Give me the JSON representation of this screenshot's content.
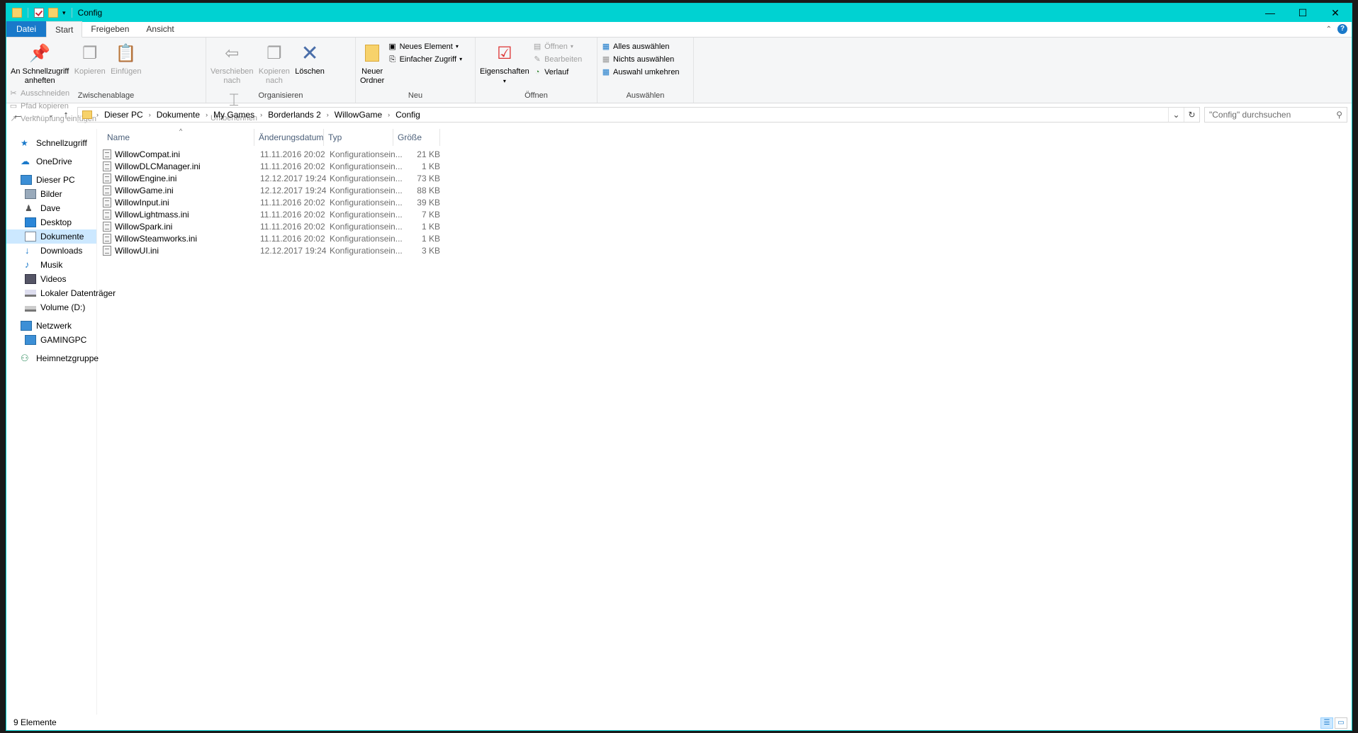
{
  "window": {
    "title": "Config",
    "minimize": "—",
    "maximize": "☐",
    "close": "✕"
  },
  "tabs": {
    "file": "Datei",
    "start": "Start",
    "share": "Freigeben",
    "view": "Ansicht"
  },
  "ribbon": {
    "clipboard": {
      "label": "Zwischenablage",
      "pin_line1": "An Schnellzugriff",
      "pin_line2": "anheften",
      "copy": "Kopieren",
      "paste": "Einfügen",
      "cut": "Ausschneiden",
      "copy_path": "Pfad kopieren",
      "paste_shortcut": "Verknüpfung einfügen"
    },
    "organize": {
      "label": "Organisieren",
      "move_line1": "Verschieben",
      "move_line2": "nach",
      "copyto_line1": "Kopieren",
      "copyto_line2": "nach",
      "delete": "Löschen",
      "rename": "Umbenennen"
    },
    "new": {
      "label": "Neu",
      "new_folder_line1": "Neuer",
      "new_folder_line2": "Ordner",
      "new_item": "Neues Element",
      "easy_access": "Einfacher Zugriff"
    },
    "open": {
      "label": "Öffnen",
      "properties": "Eigenschaften",
      "open": "Öffnen",
      "edit": "Bearbeiten",
      "history": "Verlauf"
    },
    "select": {
      "label": "Auswählen",
      "select_all": "Alles auswählen",
      "select_none": "Nichts auswählen",
      "invert": "Auswahl umkehren"
    }
  },
  "address": {
    "crumbs": [
      "Dieser PC",
      "Dokumente",
      "My Games",
      "Borderlands 2",
      "WillowGame",
      "Config"
    ],
    "search_placeholder": "\"Config\" durchsuchen"
  },
  "nav": {
    "quick_access": "Schnellzugriff",
    "onedrive": "OneDrive",
    "this_pc": "Dieser PC",
    "pictures": "Bilder",
    "dave": "Dave",
    "desktop": "Desktop",
    "documents": "Dokumente",
    "downloads": "Downloads",
    "music": "Musik",
    "videos": "Videos",
    "local_disk": "Lokaler Datenträger",
    "volume_d": "Volume (D:)",
    "network": "Netzwerk",
    "gamingpc": "GAMINGPC",
    "homegroup": "Heimnetzgruppe"
  },
  "columns": {
    "name": "Name",
    "date": "Änderungsdatum",
    "type": "Typ",
    "size": "Größe"
  },
  "files": [
    {
      "name": "WillowCompat.ini",
      "date": "11.11.2016 20:02",
      "type": "Konfigurationsein...",
      "size": "21 KB"
    },
    {
      "name": "WillowDLCManager.ini",
      "date": "11.11.2016 20:02",
      "type": "Konfigurationsein...",
      "size": "1 KB"
    },
    {
      "name": "WillowEngine.ini",
      "date": "12.12.2017 19:24",
      "type": "Konfigurationsein...",
      "size": "73 KB"
    },
    {
      "name": "WillowGame.ini",
      "date": "12.12.2017 19:24",
      "type": "Konfigurationsein...",
      "size": "88 KB"
    },
    {
      "name": "WillowInput.ini",
      "date": "11.11.2016 20:02",
      "type": "Konfigurationsein...",
      "size": "39 KB"
    },
    {
      "name": "WillowLightmass.ini",
      "date": "11.11.2016 20:02",
      "type": "Konfigurationsein...",
      "size": "7 KB"
    },
    {
      "name": "WillowSpark.ini",
      "date": "11.11.2016 20:02",
      "type": "Konfigurationsein...",
      "size": "1 KB"
    },
    {
      "name": "WillowSteamworks.ini",
      "date": "11.11.2016 20:02",
      "type": "Konfigurationsein...",
      "size": "1 KB"
    },
    {
      "name": "WillowUI.ini",
      "date": "12.12.2017 19:24",
      "type": "Konfigurationsein...",
      "size": "3 KB"
    }
  ],
  "status": {
    "count": "9 Elemente"
  },
  "colors": {
    "titlebar": "#00d2d2",
    "accent": "#1979ca",
    "selection": "#cce8ff"
  }
}
